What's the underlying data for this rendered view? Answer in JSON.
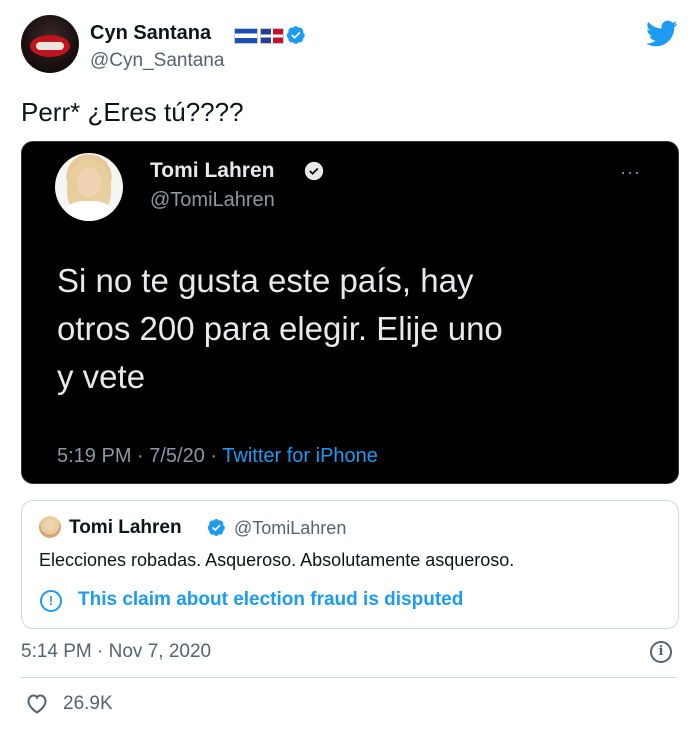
{
  "tweet": {
    "author_name": "Cyn Santana",
    "author_handle": "@Cyn_Santana",
    "text": "Perr* ¿Eres tú????",
    "timestamp": "5:14 PM · Nov 7, 2020",
    "likes": "26.9K",
    "icons": [
      "flag-el-salvador-icon",
      "flag-dominican-republic-icon",
      "verified-badge-icon",
      "twitter-bird-icon",
      "info-icon",
      "heart-icon"
    ]
  },
  "screenshot": {
    "author_name": "Tomi Lahren",
    "author_handle": "@TomiLahren",
    "text_line1": "Si no te gusta este país, hay",
    "text_line2": "otros 200 para elegir. Elije uno",
    "text_line3": "y vete",
    "time": "5:19 PM · 7/5/20 · ",
    "source": "Twitter for iPhone",
    "more_label": "···"
  },
  "quoted": {
    "author_name": "Tomi Lahren",
    "author_handle": "@TomiLahren",
    "text": "Elecciones robadas. Asqueroso. Absolutamente asqueroso.",
    "warning": "This claim about election fraud is disputed",
    "warning_icon_glyph": "!"
  },
  "colors": {
    "accent": "#1d9bf0",
    "text": "#0f1419",
    "muted": "#536471",
    "card_bg": "#000000"
  }
}
